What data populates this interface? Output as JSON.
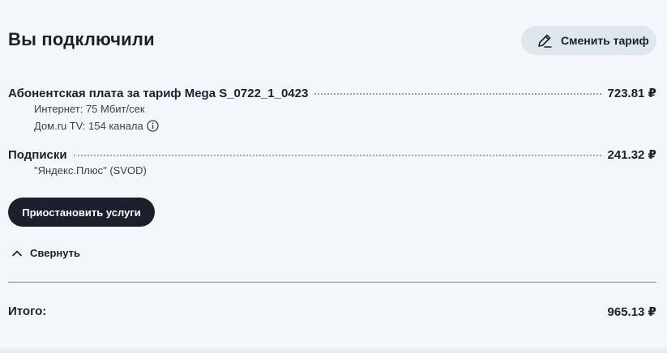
{
  "header": {
    "title": "Вы подключили",
    "change_tariff_label": "Сменить тариф",
    "change_tariff_icon": "pencil-icon"
  },
  "items": [
    {
      "label": "Абонентская плата за тариф Mega S_0722_1_0423",
      "amount": "723.81 ₽",
      "details": [
        "Интернет: 75 Мбит/сек",
        "Дом.ru TV: 154 канала"
      ]
    },
    {
      "label": "Подписки",
      "amount": "241.32 ₽",
      "details": [
        "\"Яндекс.Плюс\" (SVOD)"
      ]
    }
  ],
  "actions": {
    "pause_label": "Приостановить услуги",
    "collapse_label": "Свернуть",
    "collapse_icon": "chevron-up-icon"
  },
  "total": {
    "label": "Итого:",
    "amount": "965.13 ₽"
  },
  "colors": {
    "background": "#f3f6fa",
    "dark": "#1d1f2d",
    "button_light": "#dfe7ee"
  }
}
